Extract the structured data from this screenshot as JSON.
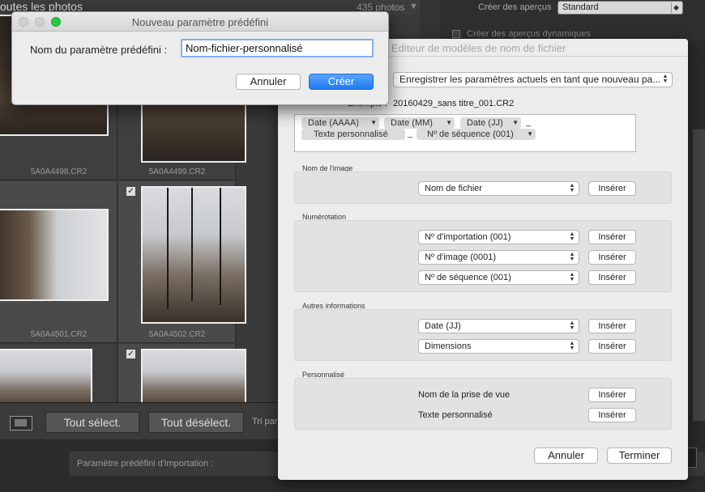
{
  "grid": {
    "title": "outes les photos",
    "photo_count": "435 photos",
    "files": [
      "5A0A4498.CR2",
      "5A0A4499.CR2",
      "5A0A4501.CR2",
      "5A0A4502.CR2"
    ],
    "checkmark": "✓"
  },
  "toolbar": {
    "select_all": "Tout sélect.",
    "deselect_all": "Tout désélect.",
    "sort_label": "Tri par"
  },
  "import_bar": {
    "preset_label": "Paramètre prédéfini d'importation :"
  },
  "right_panel": {
    "previews_label": "Créer des aperçus",
    "previews_value": "Standard",
    "smart_previews_label": "Créer des aperçus dynamiques"
  },
  "editor": {
    "title": "Editeur de modèles de nom de fichier",
    "preset_value": "Enregistrer les paramètres actuels en tant que nouveau pa...",
    "example_label": "Exemple :",
    "example_value": "20160429_sans titre_001.CR2",
    "tokens": {
      "date_yyyy": "Date (AAAA)",
      "date_mm": "Date (MM)",
      "date_dd": "Date (JJ)",
      "custom_text": "Texte personnalisé",
      "sequence": "Nº de séquence (001)",
      "separator": "_"
    },
    "sections": {
      "image_name": {
        "label": "Nom de l'image",
        "popups": [
          "Nom de fichier"
        ]
      },
      "numbering": {
        "label": "Numérotation",
        "popups": [
          "Nº d'importation (001)",
          "Nº d'image (0001)",
          "Nº de séquence (001)"
        ]
      },
      "other_info": {
        "label": "Autres informations",
        "popups": [
          "Date (JJ)",
          "Dimensions"
        ]
      },
      "custom": {
        "label": "Personnalisé",
        "rows": [
          "Nom de la prise de vue",
          "Texte personnalisé"
        ]
      }
    },
    "insert_label": "Insérer",
    "cancel_label": "Annuler",
    "done_label": "Terminer"
  },
  "preset_dialog": {
    "title": "Nouveau paramètre prédéfini",
    "name_label": "Nom du paramètre prédéfini :",
    "name_value": "Nom-fichier-personnalisé",
    "cancel_label": "Annuler",
    "create_label": "Créer"
  },
  "colors": {
    "accent": "#1f7bf0",
    "close": "#fe5f57",
    "zoom": "#28c840",
    "inactive_light": "#d0d0d0"
  }
}
